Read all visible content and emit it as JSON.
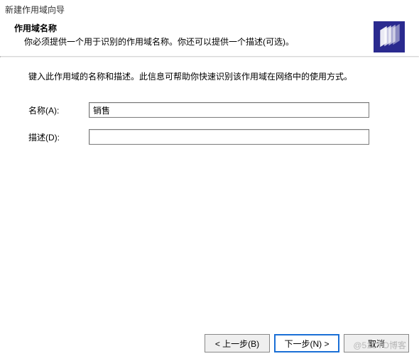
{
  "window": {
    "title": "新建作用域向导"
  },
  "header": {
    "title": "作用域名称",
    "description": "你必须提供一个用于识别的作用域名称。你还可以提供一个描述(可选)。"
  },
  "content": {
    "instruction": "键入此作用域的名称和描述。此信息可帮助你快速识别该作用域在网络中的使用方式。",
    "name_label": "名称(A):",
    "name_value": "销售",
    "desc_label": "描述(D):",
    "desc_value": ""
  },
  "footer": {
    "back": "< 上一步(B)",
    "next": "下一步(N) >",
    "cancel": "取消"
  },
  "watermark": "@51CTO博客"
}
